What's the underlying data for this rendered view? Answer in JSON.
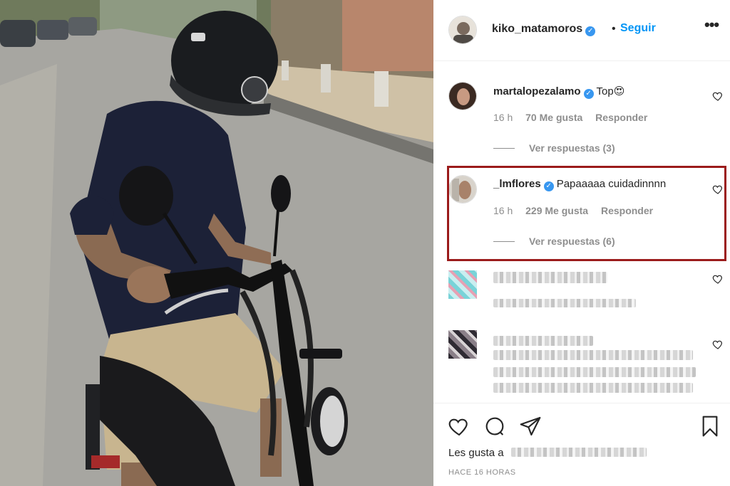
{
  "post": {
    "owner": "kiko_matamoros",
    "follow_separator": "•",
    "follow_label": "Seguir",
    "more_label": "•••"
  },
  "comments": [
    {
      "user": "martalopezalamo",
      "verified": true,
      "text": "Top😍",
      "time": "16 h",
      "likes": "70 Me gusta",
      "reply": "Responder",
      "view_replies": "Ver respuestas (3)"
    },
    {
      "user": "_lmflores",
      "verified": true,
      "text": "Papaaaaa cuidadinnnn",
      "time": "16 h",
      "likes": "229 Me gusta",
      "reply": "Responder",
      "view_replies": "Ver respuestas (6)",
      "highlighted": true
    }
  ],
  "footer": {
    "likes_prefix": "Les gusta a",
    "timestamp": "HACE 16 HORAS"
  },
  "colors": {
    "link_blue": "#0095f6",
    "verified_blue": "#3897f0",
    "highlight_border": "#9b1b1b",
    "muted_text": "#8e8e8e"
  },
  "icons": [
    "heart-icon",
    "comment-icon",
    "share-icon",
    "bookmark-icon",
    "more-icon",
    "verified-icon"
  ]
}
